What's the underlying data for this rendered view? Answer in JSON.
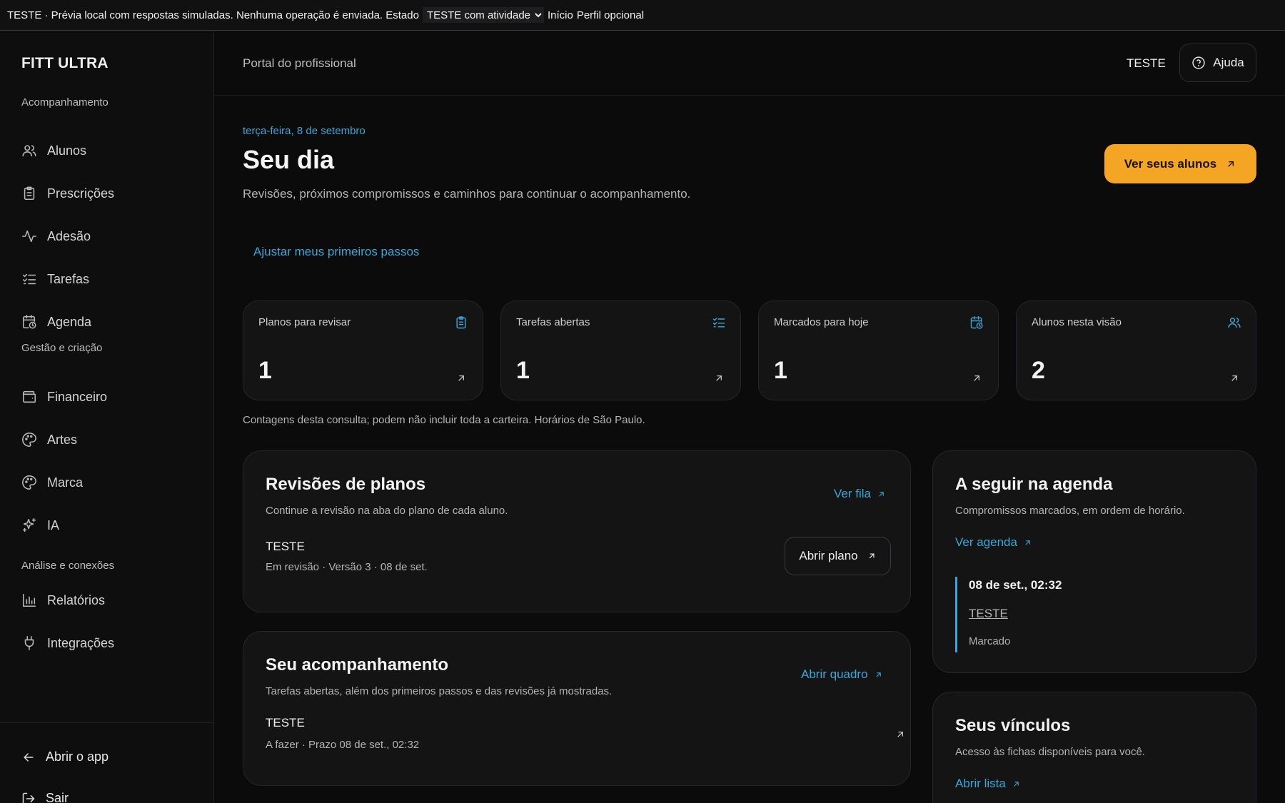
{
  "topbar": {
    "prefix": "TESTE · Prévia local com respostas simuladas. Nenhuma operação é enviada. Estado",
    "state_value": "TESTE com atividade",
    "link_home": "Início",
    "link_profile": "Perfil opcional"
  },
  "sidebar": {
    "brand": "FITT ULTRA",
    "sections": [
      {
        "label": "Acompanhamento",
        "items": [
          {
            "label": "Alunos",
            "icon": "users-icon"
          },
          {
            "label": "Prescrições",
            "icon": "clipboard-icon"
          },
          {
            "label": "Adesão",
            "icon": "activity-icon"
          },
          {
            "label": "Tarefas",
            "icon": "checklist-icon"
          },
          {
            "label": "Agenda",
            "icon": "calendar-clock-icon"
          }
        ]
      },
      {
        "label": "Gestão e criação",
        "items": [
          {
            "label": "Financeiro",
            "icon": "wallet-icon"
          },
          {
            "label": "Artes",
            "icon": "palette-icon"
          },
          {
            "label": "Marca",
            "icon": "palette-icon"
          },
          {
            "label": "IA",
            "icon": "sparkles-icon"
          }
        ]
      },
      {
        "label": "Análise e conexões",
        "items": [
          {
            "label": "Relatórios",
            "icon": "bar-chart-icon"
          },
          {
            "label": "Integrações",
            "icon": "plug-icon"
          }
        ]
      }
    ],
    "open_app": "Abrir o app",
    "logout": "Sair"
  },
  "header": {
    "portal": "Portal do profissional",
    "user": "TESTE",
    "help": "Ajuda"
  },
  "main": {
    "date": "terça-feira, 8 de setembro",
    "title": "Seu dia",
    "subtitle": "Revisões, próximos compromissos e caminhos para continuar o acompanhamento.",
    "cta": "Ver seus alunos",
    "first_steps": "Ajustar meus primeiros passos",
    "stats": [
      {
        "label": "Planos para revisar",
        "value": "1",
        "icon": "clipboard-icon"
      },
      {
        "label": "Tarefas abertas",
        "value": "1",
        "icon": "checklist-icon"
      },
      {
        "label": "Marcados para hoje",
        "value": "1",
        "icon": "calendar-clock-icon"
      },
      {
        "label": "Alunos nesta visão",
        "value": "2",
        "icon": "users-icon"
      }
    ],
    "note": "Contagens desta consulta; podem não incluir toda a carteira. Horários de São Paulo."
  },
  "reviews": {
    "title": "Revisões de planos",
    "desc": "Continue a revisão na aba do plano de cada aluno.",
    "link": "Ver fila",
    "item_name": "TESTE",
    "item_meta": "Em revisão · Versão 3 · 08 de set.",
    "open_plan": "Abrir plano"
  },
  "follow": {
    "title": "Seu acompanhamento",
    "desc": "Tarefas abertas, além dos primeiros passos e das revisões já mostradas.",
    "link": "Abrir quadro",
    "item_name": "TESTE",
    "item_meta": "A fazer · Prazo 08 de set., 02:32"
  },
  "agenda": {
    "title": "A seguir na agenda",
    "desc": "Compromissos marcados, em ordem de horário.",
    "link": "Ver agenda",
    "entry_when": "08 de set., 02:32",
    "entry_who": "TESTE",
    "entry_state": "Marcado"
  },
  "links_card": {
    "title": "Seus vínculos",
    "desc": "Acesso às fichas disponíveis para você.",
    "link": "Abrir lista"
  },
  "colors": {
    "accent": "#3aa7d8",
    "cta": "#f5a524",
    "background": "#0b0b0c",
    "card": "#141415"
  }
}
